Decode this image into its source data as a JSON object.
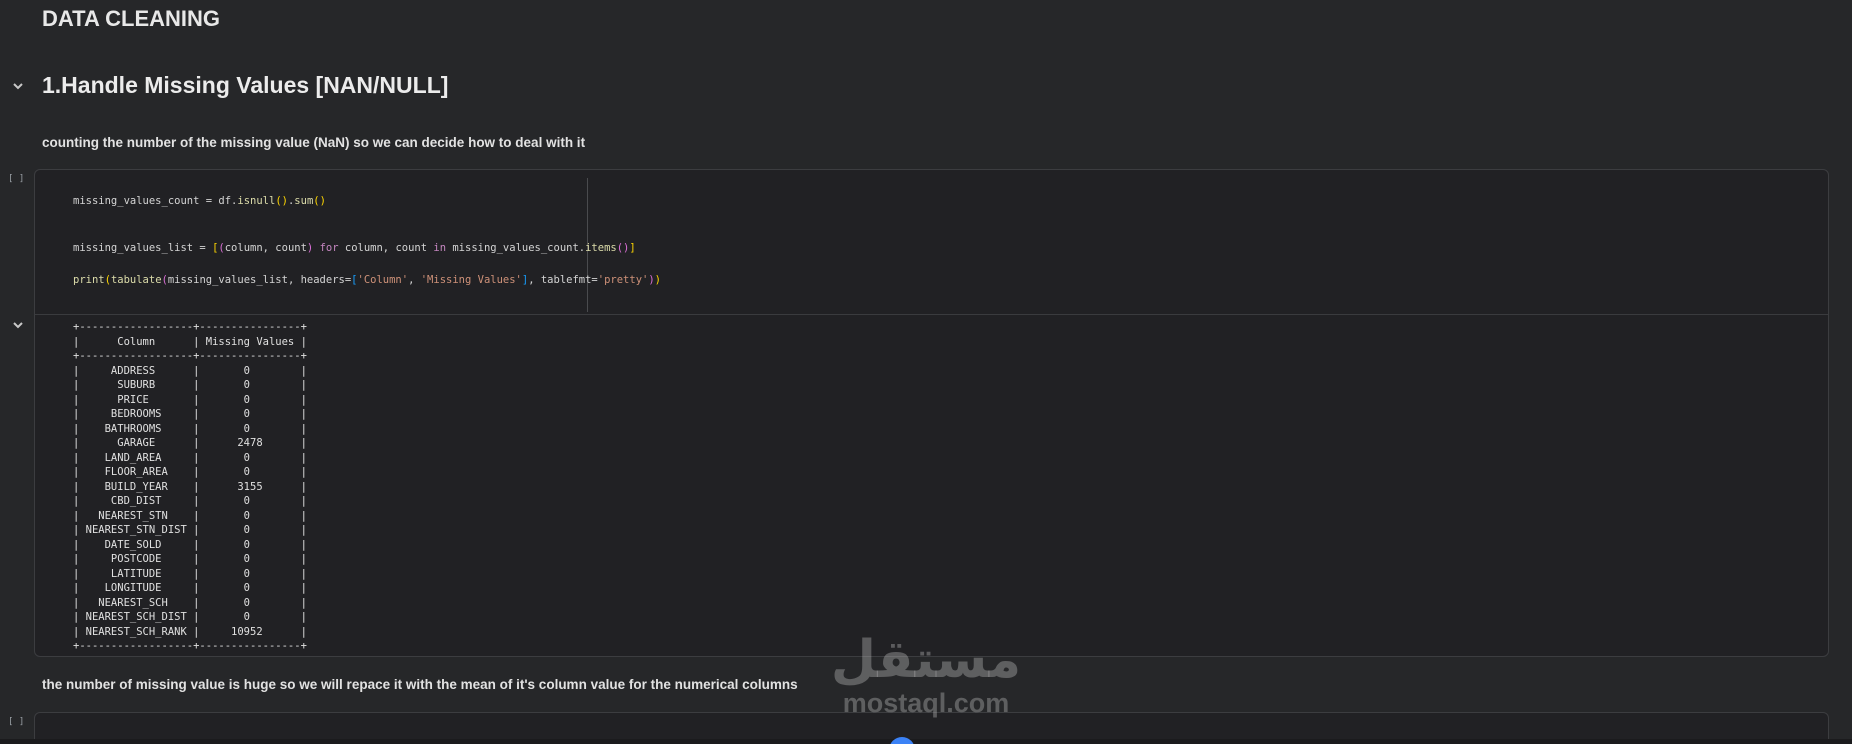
{
  "notebook": {
    "section_title": "DATA CLEANING",
    "heading": "1.Handle Missing Values [NAN/NULL]",
    "intro_text": "counting the number of the missing value (NaN) so we can decide how to deal with it",
    "followup_text": "the number of missing value is huge so we will repace it with the mean of it's column value for the numerical columns",
    "run_slot_label": "[ ]"
  },
  "code": {
    "line1": "missing_values_count = df.isnull().sum()",
    "line2": "missing_values_list = [(column, count) for column, count in missing_values_count.items()]",
    "line3": "print(tabulate(missing_values_list, headers=['Column', 'Missing Values'], tablefmt='pretty'))"
  },
  "output": {
    "headers": [
      "Column",
      "Missing Values"
    ],
    "rows": [
      [
        "ADDRESS",
        "0"
      ],
      [
        "SUBURB",
        "0"
      ],
      [
        "PRICE",
        "0"
      ],
      [
        "BEDROOMS",
        "0"
      ],
      [
        "BATHROOMS",
        "0"
      ],
      [
        "GARAGE",
        "2478"
      ],
      [
        "LAND_AREA",
        "0"
      ],
      [
        "FLOOR_AREA",
        "0"
      ],
      [
        "BUILD_YEAR",
        "3155"
      ],
      [
        "CBD_DIST",
        "0"
      ],
      [
        "NEAREST_STN",
        "0"
      ],
      [
        "NEAREST_STN_DIST",
        "0"
      ],
      [
        "DATE_SOLD",
        "0"
      ],
      [
        "POSTCODE",
        "0"
      ],
      [
        "LATITUDE",
        "0"
      ],
      [
        "LONGITUDE",
        "0"
      ],
      [
        "NEAREST_SCH",
        "0"
      ],
      [
        "NEAREST_SCH_DIST",
        "0"
      ],
      [
        "NEAREST_SCH_RANK",
        "10952"
      ]
    ],
    "table_text": ""
  },
  "watermark": {
    "logo_text": "مستقل",
    "domain": "mostaql.com"
  },
  "icons": {
    "collapse": "chevron-down-icon"
  },
  "colors": {
    "background": "#262729",
    "cell_background": "#212124",
    "accent_blue": "#3b82f6"
  }
}
